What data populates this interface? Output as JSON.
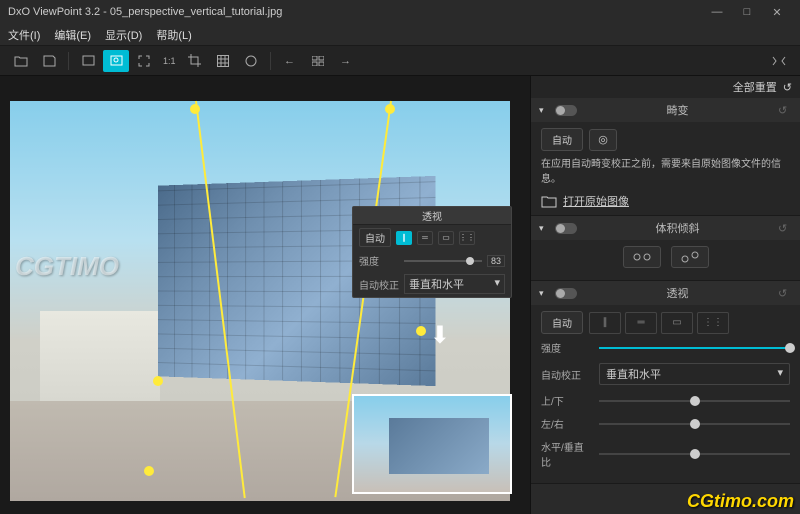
{
  "title": "DxO ViewPoint 3.2 - 05_perspective_vertical_tutorial.jpg",
  "menu": {
    "file": "文件(I)",
    "edit": "编辑(E)",
    "view": "显示(D)",
    "help": "帮助(L)"
  },
  "win": {
    "min": "—",
    "max": "□",
    "close": "✕"
  },
  "toolbar": {
    "zoom11": "1:1"
  },
  "panel_header": {
    "reset_all": "全部重置",
    "icon": "↺"
  },
  "sections": {
    "distortion": {
      "title": "畸变",
      "auto": "自动",
      "info": "在应用自动畸变校正之前，需要来自原始图像文件的信息。",
      "link": "打开原始图像"
    },
    "volume": {
      "title": "体积倾斜"
    },
    "perspective": {
      "title": "透视",
      "auto": "自动",
      "intensity": {
        "label": "强度"
      },
      "autocorrect": {
        "label": "自动校正",
        "value": "垂直和水平"
      },
      "ud": {
        "label": "上/下"
      },
      "lr": {
        "label": "左/右"
      },
      "hv": {
        "label": "水平/垂直比"
      }
    }
  },
  "mini": {
    "title": "透视",
    "auto": "自动",
    "intensity": {
      "label": "强度",
      "value": "83"
    },
    "autocorrect": {
      "label": "自动校正",
      "value": "垂直和水平"
    }
  },
  "watermark_canvas": "CGTIMO",
  "watermark_footer": "CGtimo.com"
}
